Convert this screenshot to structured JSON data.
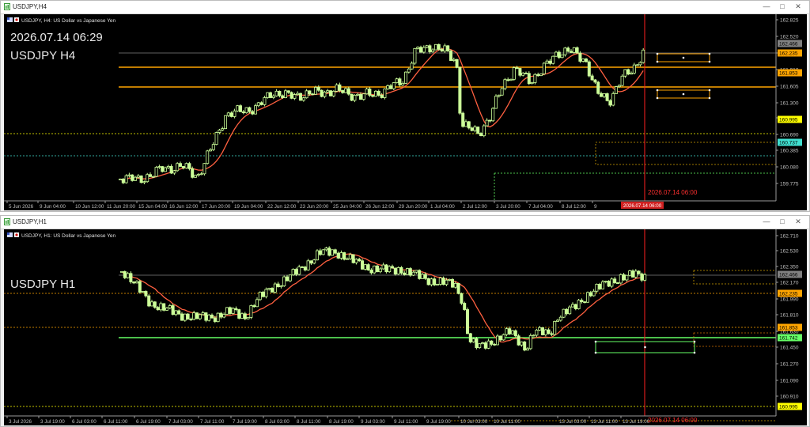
{
  "windows": [
    {
      "window_title": "USDJPY,H4",
      "symbol_header": "USDJPY, H4:  US Dollar vs Japanese Yen",
      "overlay_time": "2026.07.14 06:29",
      "overlay_label": "USDJPY H4",
      "price_ticks": [
        "162.825",
        "162.520",
        "162.215",
        "161.910",
        "161.605",
        "161.300",
        "160.995",
        "160.690",
        "160.385",
        "160.080",
        "159.775"
      ],
      "price_boxes": [
        "162.466",
        "162.235",
        "161.853",
        "160.995",
        "160.737"
      ],
      "time_labels": [
        "5 Jun 2026",
        "9 Jun 04:00",
        "10 Jun 12:00",
        "11 Jun 20:00",
        "15 Jun 04:00",
        "16 Jun 12:00",
        "17 Jun 20:00",
        "19 Jun 04:00",
        "22 Jun 12:00",
        "23 Jun 20:00",
        "25 Jun 04:00",
        "26 Jun 12:00",
        "29 Jun 20:00",
        "1 Jul 04:00",
        "2 Jul 12:00",
        "3 Jul 20:00",
        "7 Jul 04:00",
        "8 Jul 12:00",
        "9"
      ],
      "vline_label": "2026.07.14 06:00",
      "vline_time_box": "2026.07.14 06:00"
    },
    {
      "window_title": "USDJPY,H1",
      "symbol_header": "USDJPY, H1:  US Dollar vs Japanese Yen",
      "overlay_label": "USDJPY H1",
      "price_ticks": [
        "162.710",
        "162.530",
        "162.350",
        "162.170",
        "161.990",
        "161.810",
        "161.630",
        "161.450",
        "161.270",
        "161.090",
        "160.910"
      ],
      "price_boxes": [
        "162.466",
        "162.235",
        "161.853",
        "161.742",
        "160.995"
      ],
      "time_labels": [
        "3 Jul 2026",
        "3 Jul 19:00",
        "6 Jul 03:00",
        "6 Jul 11:00",
        "6 Jul 19:00",
        "7 Jul 03:00",
        "7 Jul 11:00",
        "7 Jul 19:00",
        "8 Jul 03:00",
        "8 Jul 11:00",
        "8 Jul 19:00",
        "9 Jul 03:00",
        "9 Jul 11:00",
        "9 Jul 19:00",
        "10 Jul 03:00",
        "10 Jul 11:00",
        "13 Jul 03:00",
        "13 Jul 11:00",
        "13 Jul 19:00"
      ],
      "vline_label": "2026.07.14 06:00",
      "vline_time_box": "2026.07.14 06:00"
    }
  ],
  "icons": [
    "chart-window-icon",
    "minimize-icon",
    "maximize-icon",
    "close-icon",
    "flag-icon"
  ],
  "colors": {
    "background": "#000000",
    "bull_candle": "#ccff99",
    "bear_candle": "#ccff99",
    "moving_average": "#ff6040",
    "level_orange": "#ffa500",
    "level_green": "#66ff66",
    "level_yellow": "#ffff00",
    "level_cyan": "#40e0d0",
    "current_time_line": "#ff2020",
    "grid_text": "#c0c0c0"
  }
}
